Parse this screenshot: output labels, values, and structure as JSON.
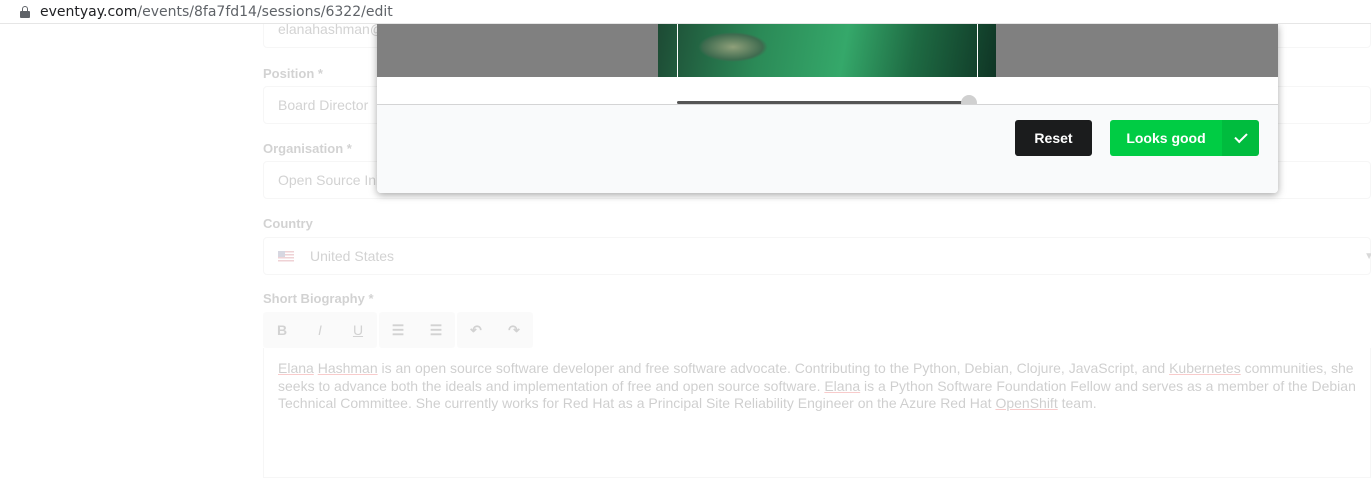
{
  "browser": {
    "url_host": "eventyay.com",
    "url_path": "/events/8fa7fd14/sessions/6322/edit"
  },
  "form": {
    "email_partial": "elanahashman@...",
    "position_label": "Position *",
    "position_value": "Board Director",
    "organisation_label": "Organisation *",
    "organisation_value": "Open Source Initiative",
    "country_label": "Country",
    "country_value": "United States",
    "bio_label": "Short Biography *",
    "toolbar": {
      "bold": "B",
      "italic": "I",
      "underline": "U",
      "ordered_list": "☰",
      "bullet_list": "☰",
      "undo": "↶",
      "redo": "↷"
    },
    "bio_parts": {
      "p1": "Elana",
      "p2": " ",
      "p3": "Hashman",
      "p4": " is an open source software developer and free software advocate. Contributing to the Python, Debian, Clojure, JavaScript, and ",
      "p5": "Kubernetes",
      "p6": " communities, she seeks to advance both the ideals and implementation of free and open source software. ",
      "p7": "Elana",
      "p8": " is a Python Software Foundation Fellow and serves as a member of the Debian Technical Committee. She currently works for Red Hat as a Principal Site Reliability Engineer on the Azure Red Hat ",
      "p9": "OpenShift",
      "p10": " team."
    }
  },
  "modal": {
    "zoom_level": 1.0,
    "reset_label": "Reset",
    "confirm_label": "Looks good",
    "icons": {
      "confirm": "check-icon"
    }
  },
  "colors": {
    "confirm_green": "#00cc44",
    "reset_black": "#1b1c1d"
  }
}
